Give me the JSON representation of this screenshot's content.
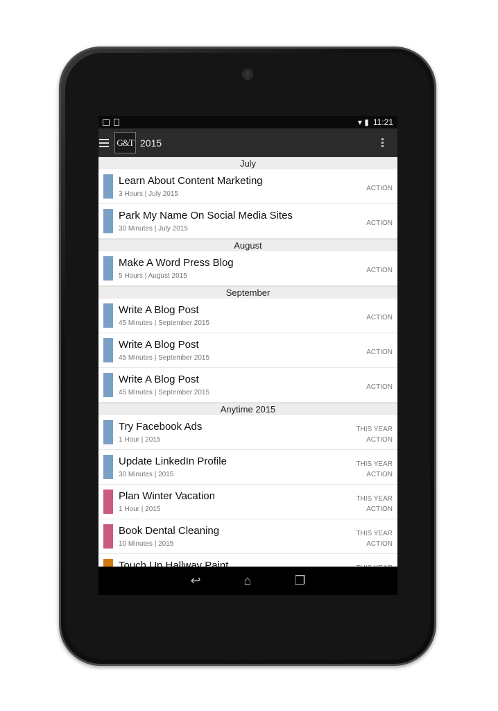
{
  "status": {
    "time": "11:21"
  },
  "appbar": {
    "logo": "G&T",
    "title": "2015"
  },
  "colors": {
    "blue": "#7aa0c4",
    "pink": "#c95b80",
    "orange": "#d4790f"
  },
  "sections": [
    {
      "header": "July",
      "rows": [
        {
          "title": "Learn About Content Marketing",
          "sub": "3 Hours | July 2015",
          "tag1": "",
          "tag2": "ACTION",
          "color": "#7aa0c4"
        },
        {
          "title": "Park My Name On Social Media Sites",
          "sub": "30 Minutes | July 2015",
          "tag1": "",
          "tag2": "ACTION",
          "color": "#7aa0c4"
        }
      ]
    },
    {
      "header": "August",
      "rows": [
        {
          "title": "Make A Word Press Blog",
          "sub": "5 Hours | August 2015",
          "tag1": "",
          "tag2": "ACTION",
          "color": "#7aa0c4"
        }
      ]
    },
    {
      "header": "September",
      "rows": [
        {
          "title": "Write A Blog Post",
          "sub": "45 Minutes | September 2015",
          "tag1": "",
          "tag2": "ACTION",
          "color": "#7aa0c4"
        },
        {
          "title": "Write A Blog Post",
          "sub": "45 Minutes | September 2015",
          "tag1": "",
          "tag2": "ACTION",
          "color": "#7aa0c4"
        },
        {
          "title": "Write A Blog Post",
          "sub": "45 Minutes | September 2015",
          "tag1": "",
          "tag2": "ACTION",
          "color": "#7aa0c4"
        }
      ]
    },
    {
      "header": "Anytime 2015",
      "rows": [
        {
          "title": "Try Facebook Ads",
          "sub": "1 Hour | 2015",
          "tag1": "THIS YEAR",
          "tag2": "ACTION",
          "color": "#7aa0c4"
        },
        {
          "title": "Update LinkedIn Profile",
          "sub": "30 Minutes | 2015",
          "tag1": "THIS YEAR",
          "tag2": "ACTION",
          "color": "#7aa0c4"
        },
        {
          "title": "Plan Winter Vacation",
          "sub": "1 Hour | 2015",
          "tag1": "THIS YEAR",
          "tag2": "ACTION",
          "color": "#c95b80"
        },
        {
          "title": "Book Dental Cleaning",
          "sub": "10 Minutes | 2015",
          "tag1": "THIS YEAR",
          "tag2": "ACTION",
          "color": "#c95b80"
        },
        {
          "title": "Touch Up Hallway Paint",
          "sub": "",
          "tag1": "THIS YEAR",
          "tag2": "",
          "color": "#d4790f"
        }
      ]
    }
  ]
}
